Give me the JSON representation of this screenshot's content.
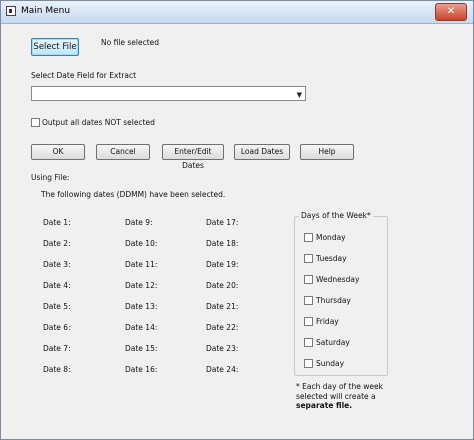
{
  "window": {
    "title": "Main Menu",
    "close_glyph": "✕"
  },
  "file": {
    "select_button": "Select File",
    "status": "No file selected"
  },
  "date_field": {
    "label": "Select Date Field for Extract",
    "value": "",
    "arrow": "▼"
  },
  "output_not_selected": {
    "label": "Output all dates NOT selected",
    "checked": false
  },
  "toolbar": {
    "ok": "OK",
    "cancel": "Cancel",
    "enter_edit": "Enter/Edit Dates",
    "load": "Load Dates",
    "help": "Help"
  },
  "using_file_label": "Using File:",
  "selected_heading": "The following dates (DDMM) have been selected.",
  "dates": {
    "col1": [
      {
        "label": "Date 1:",
        "value": ""
      },
      {
        "label": "Date 2:",
        "value": ""
      },
      {
        "label": "Date 3:",
        "value": ""
      },
      {
        "label": "Date 4:",
        "value": ""
      },
      {
        "label": "Date 5:",
        "value": ""
      },
      {
        "label": "Date 6:",
        "value": ""
      },
      {
        "label": "Date 7:",
        "value": ""
      },
      {
        "label": "Date 8:",
        "value": ""
      }
    ],
    "col2": [
      {
        "label": "Date 9:",
        "value": ""
      },
      {
        "label": "Date 10:",
        "value": ""
      },
      {
        "label": "Date 11:",
        "value": ""
      },
      {
        "label": "Date 12:",
        "value": ""
      },
      {
        "label": "Date 13:",
        "value": ""
      },
      {
        "label": "Date 14:",
        "value": ""
      },
      {
        "label": "Date 15:",
        "value": ""
      },
      {
        "label": "Date 16:",
        "value": ""
      }
    ],
    "col3": [
      {
        "label": "Date 17:",
        "value": ""
      },
      {
        "label": "Date 18:",
        "value": ""
      },
      {
        "label": "Date 19:",
        "value": ""
      },
      {
        "label": "Date 20:",
        "value": ""
      },
      {
        "label": "Date 21:",
        "value": ""
      },
      {
        "label": "Date 22:",
        "value": ""
      },
      {
        "label": "Date 23:",
        "value": ""
      },
      {
        "label": "Date 24:",
        "value": ""
      }
    ]
  },
  "days_of_week": {
    "title": "Days of the Week*",
    "days": [
      {
        "label": "Monday",
        "checked": false
      },
      {
        "label": "Tuesday",
        "checked": false
      },
      {
        "label": "Wednesday",
        "checked": false
      },
      {
        "label": "Thursday",
        "checked": false
      },
      {
        "label": "Friday",
        "checked": false
      },
      {
        "label": "Saturday",
        "checked": false
      },
      {
        "label": "Sunday",
        "checked": false
      }
    ],
    "note_line1": "* Each day of the week",
    "note_line2": "selected will create a",
    "note_line3": "separate file."
  }
}
